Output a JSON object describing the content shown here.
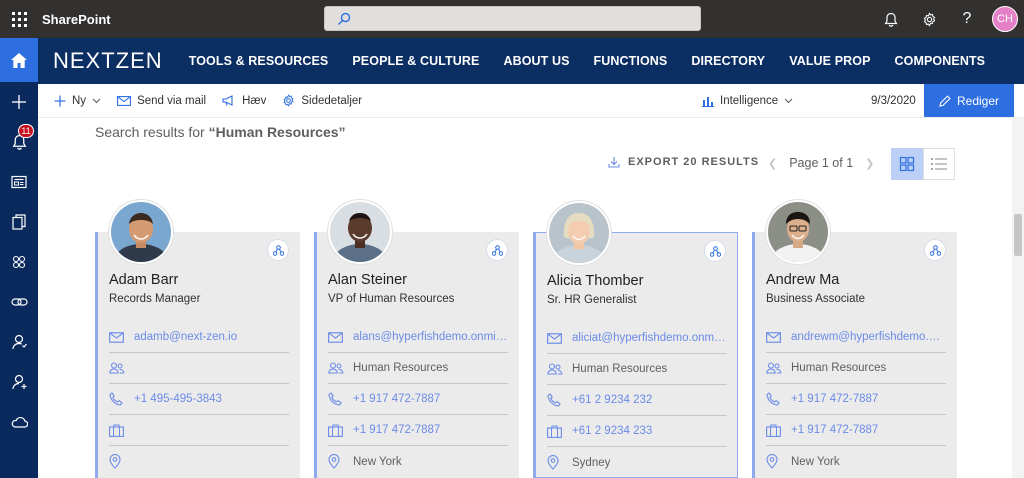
{
  "suite": {
    "brand": "SharePoint",
    "avatar_initials": "CH",
    "avatar_color": "#e481c8"
  },
  "appbar": {
    "notifications_count": "11"
  },
  "hub": {
    "logo": "NEXTZEN",
    "nav": [
      "TOOLS & RESOURCES",
      "PEOPLE & CULTURE",
      "ABOUT US",
      "FUNCTIONS",
      "DIRECTORY",
      "VALUE PROP",
      "COMPONENTS"
    ]
  },
  "command": {
    "new_label": "Ny",
    "send_label": "Send via mail",
    "promote_label": "Hæv",
    "details_label": "Sidedetaljer",
    "intelligence_label": "Intelligence",
    "date": "9/3/2020",
    "edit_label": "Rediger"
  },
  "results": {
    "prefix": "Search results for ",
    "query": "“Human Resources”",
    "export_label": "EXPORT 20 RESULTS",
    "page_label": "Page 1 of 1"
  },
  "colors": {
    "accent": "#2d6ee0",
    "hub_bg": "#0b2e63",
    "link": "#6b8be8"
  },
  "people": [
    {
      "name": "Adam Barr",
      "title": "Records Manager",
      "email": "adamb@next-zen.io",
      "department": "",
      "phone": "+1 495-495-3843",
      "office_phone": "",
      "location": ""
    },
    {
      "name": "Alan Steiner",
      "title": "VP of Human Resources",
      "email": "alans@hyperfishdemo.onmicr...",
      "department": "Human Resources",
      "phone": "+1 917 472-7887",
      "office_phone": "+1 917 472-7887",
      "location": "New York"
    },
    {
      "name": "Alicia Thomber",
      "title": "Sr. HR Generalist",
      "email": "aliciat@hyperfishdemo.onmicr...",
      "department": "Human Resources",
      "phone": "+61 2 9234 232",
      "office_phone": "+61 2 9234 233",
      "location": "Sydney"
    },
    {
      "name": "Andrew Ma",
      "title": "Business Associate",
      "email": "andrewm@hyperfishdemo.on...",
      "department": "Human Resources",
      "phone": "+1 917 472-7887",
      "office_phone": "+1 917 472-7887",
      "location": "New York"
    }
  ]
}
